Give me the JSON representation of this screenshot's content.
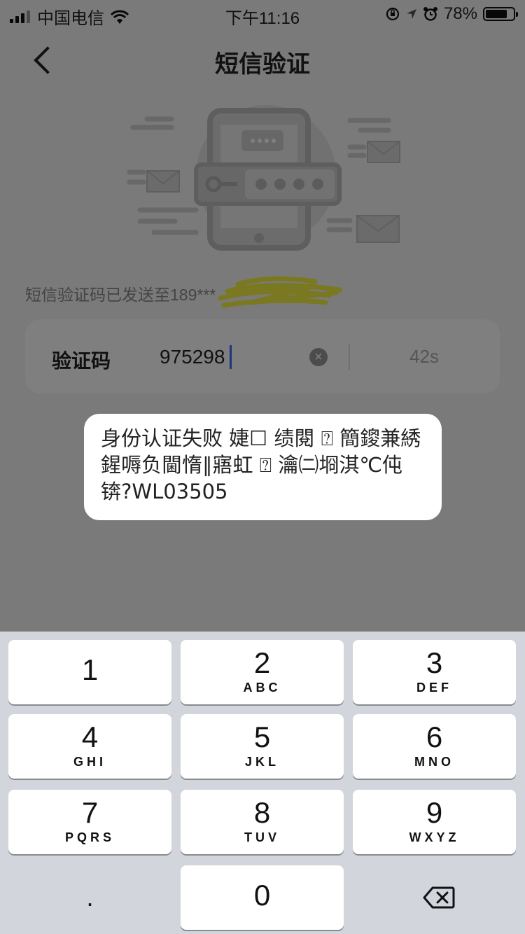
{
  "status_bar": {
    "carrier": "中国电信",
    "time": "下午11:16",
    "battery_percent": "78%",
    "battery_level": 0.78,
    "icons": [
      "signal-icon",
      "wifi-icon",
      "orientation-lock-icon",
      "location-icon",
      "alarm-icon",
      "battery-icon"
    ]
  },
  "nav": {
    "title": "短信验证",
    "back_icon": "chevron-left-icon"
  },
  "sent_info": "短信验证码已发送至189***",
  "code_field": {
    "label": "验证码",
    "value": "975298",
    "clear_icon": "clear-circle-icon",
    "countdown": "42s"
  },
  "toast": {
    "message": "身份认证失败 婕☐ 绩閱 ⍰ 簡鎫兼綉鍟嗕负閫惰∥寤虹 ⍰ 瀹㈡埛淇℃伅锛?WL03505"
  },
  "keypad": {
    "keys": [
      {
        "number": "1",
        "letters": ""
      },
      {
        "number": "2",
        "letters": "ABC"
      },
      {
        "number": "3",
        "letters": "DEF"
      },
      {
        "number": "4",
        "letters": "GHI"
      },
      {
        "number": "5",
        "letters": "JKL"
      },
      {
        "number": "6",
        "letters": "MNO"
      },
      {
        "number": "7",
        "letters": "PQRS"
      },
      {
        "number": "8",
        "letters": "TUV"
      },
      {
        "number": "9",
        "letters": "WXYZ"
      },
      {
        "number": "0",
        "letters": ""
      }
    ],
    "dot": ".",
    "delete_icon": "backspace-icon"
  },
  "colors": {
    "caret": "#3a6cf5",
    "overlay": "rgba(0,0,0,0.5)",
    "keypad_bg": "#d2d5db",
    "highlight_scribble": "#f6f33a"
  }
}
